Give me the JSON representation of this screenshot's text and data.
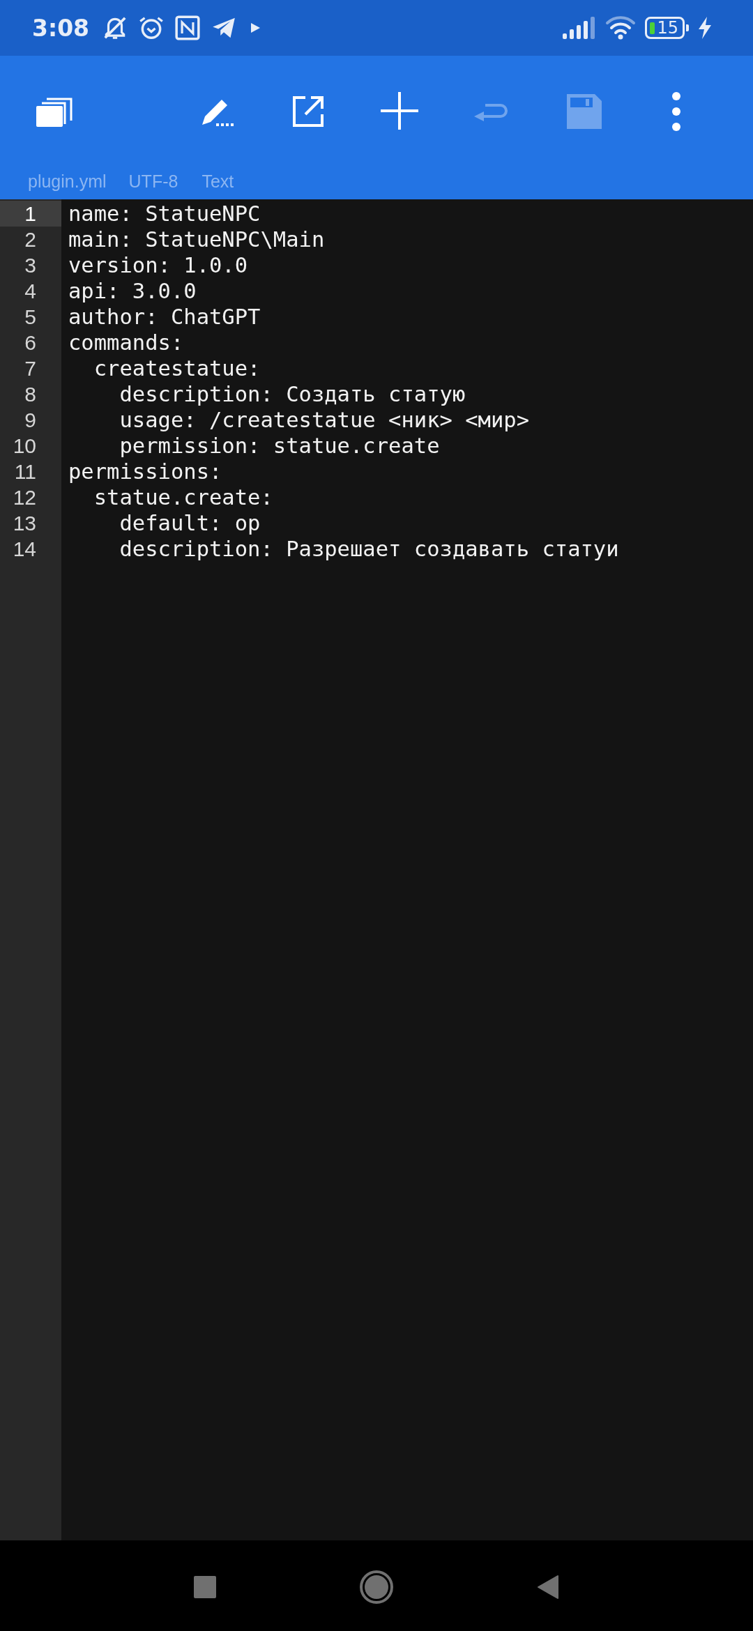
{
  "status_bar": {
    "time": "3:08",
    "battery": "15"
  },
  "toolbar": {
    "items": [
      {
        "kind": "windows",
        "disabled": false
      },
      {
        "kind": "edit",
        "disabled": false
      },
      {
        "kind": "share",
        "disabled": false
      },
      {
        "kind": "add",
        "disabled": false
      },
      {
        "kind": "undo",
        "disabled": true
      },
      {
        "kind": "save",
        "disabled": true
      },
      {
        "kind": "more",
        "disabled": false
      }
    ]
  },
  "file_info": {
    "filename": "plugin.yml",
    "encoding": "UTF-8",
    "mode": "Text"
  },
  "editor": {
    "lines": [
      {
        "number": "1",
        "text": "name: StatueNPC",
        "current": true
      },
      {
        "number": "2",
        "text": "main: StatueNPC\\Main",
        "current": false
      },
      {
        "number": "3",
        "text": "version: 1.0.0",
        "current": false
      },
      {
        "number": "4",
        "text": "api: 3.0.0",
        "current": false
      },
      {
        "number": "5",
        "text": "author: ChatGPT",
        "current": false
      },
      {
        "number": "6",
        "text": "commands:",
        "current": false
      },
      {
        "number": "7",
        "text": "  createstatue:",
        "current": false
      },
      {
        "number": "8",
        "text": "    description: Создать статую",
        "current": false
      },
      {
        "number": "9",
        "text": "    usage: /createstatue <ник> <мир>",
        "current": false
      },
      {
        "number": "10",
        "text": "    permission: statue.create",
        "current": false
      },
      {
        "number": "11",
        "text": "permissions:",
        "current": false
      },
      {
        "number": "12",
        "text": "  statue.create:",
        "current": false
      },
      {
        "number": "13",
        "text": "    default: op",
        "current": false
      },
      {
        "number": "14",
        "text": "    description: Разрешает создавать статуи",
        "current": false
      }
    ]
  }
}
